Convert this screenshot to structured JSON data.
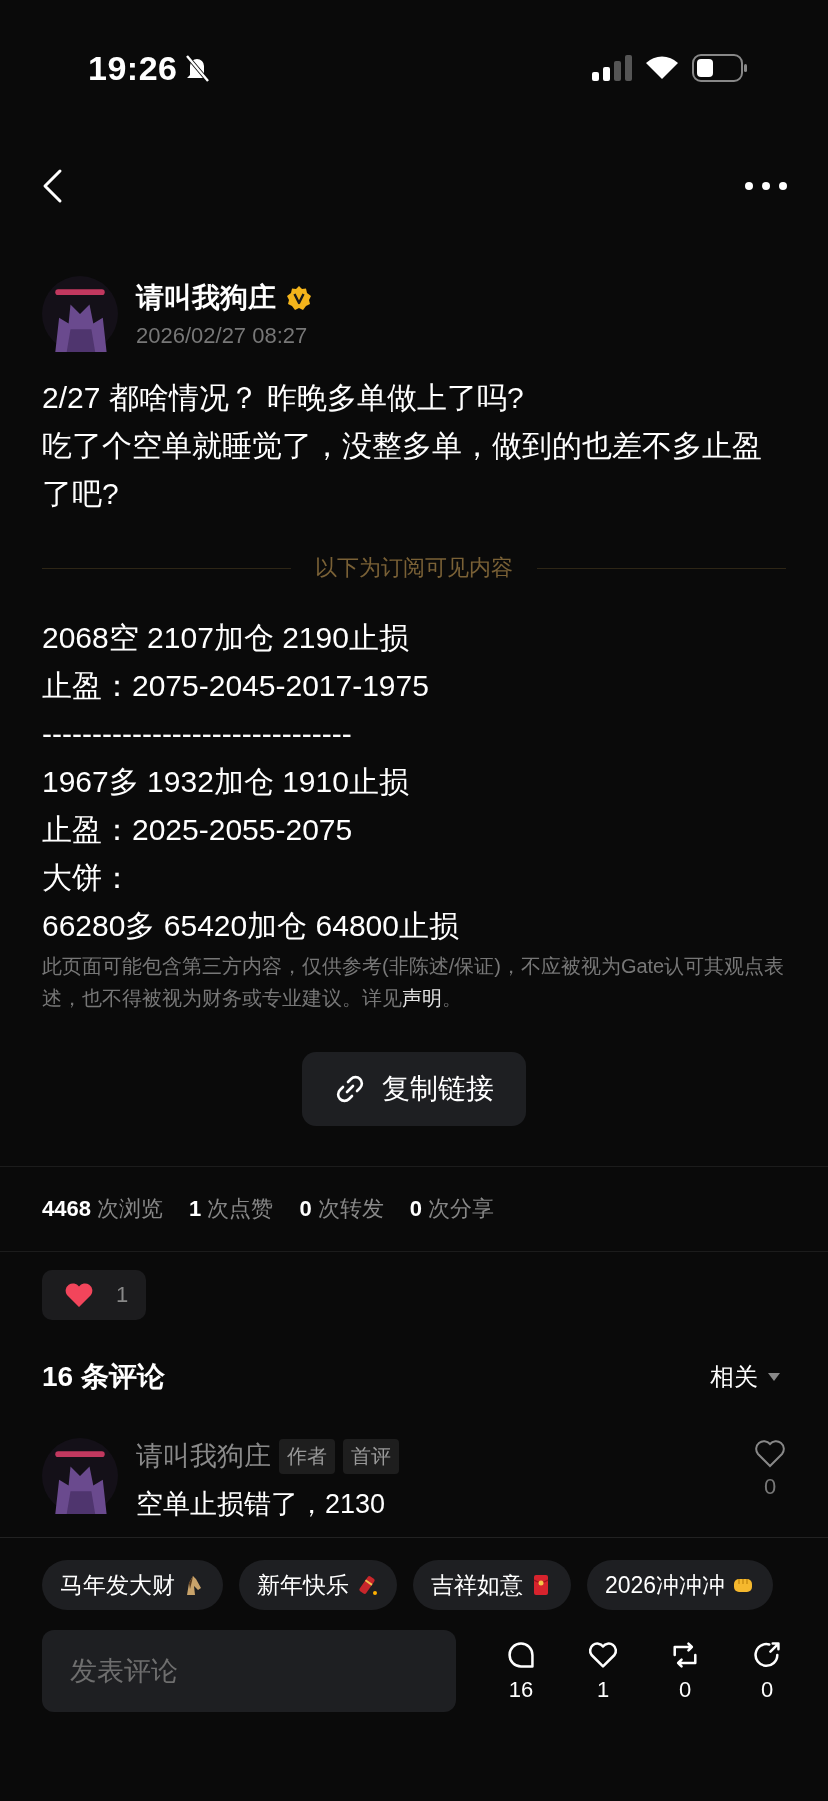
{
  "status_bar": {
    "time": "19:26",
    "silent": true
  },
  "author": {
    "name": "请叫我狗庄",
    "verified": true,
    "date": "2026/02/27 08:27"
  },
  "post": {
    "lines": [
      "2/27 都啥情况？ 昨晚多单做上了吗?",
      "吃了个空单就睡觉了，没整多单，做到的也差不多止盈了吧?"
    ],
    "paywall_label": "以下为订阅可见内容",
    "paid_lines": [
      "2068空 2107加仓 2190止损",
      "止盈：2075-2045-2017-1975",
      "-------------------------------",
      "1967多 1932加仓  1910止损",
      "止盈：2025-2055-2075",
      "大饼：",
      "66280多  65420加仓 64800止损"
    ],
    "disclaimer": {
      "text": "此页面可能包含第三方内容，仅供参考(非陈述/保证)，不应被视为Gate认可其观点表述，也不得被视为财务或专业建议。详见",
      "link": "声明",
      "tail": "。"
    },
    "copy_button": "复制链接"
  },
  "stats": [
    "**4468** 次浏览",
    "**1** 次点赞",
    "**0** 次转发",
    "**0** 次分享"
  ],
  "reaction": {
    "count": "1"
  },
  "comments_header": {
    "title": "16 条评论",
    "sort": "相关"
  },
  "comments": [
    {
      "name": "请叫我狗庄",
      "badges": [
        "作者",
        "首评"
      ],
      "text": "空单止损错了，2130",
      "likes": "0",
      "liked": false
    }
  ],
  "quick_replies": [
    {
      "label": "马年发大财",
      "kind": "horse"
    },
    {
      "label": "新年快乐",
      "kind": "firecracker"
    },
    {
      "label": "吉祥如意",
      "kind": "envelope"
    },
    {
      "label": "2026冲冲冲",
      "kind": "fist"
    }
  ],
  "comment_input": {
    "placeholder": "发表评论"
  },
  "actions": [
    {
      "kind": "comment",
      "count": "16"
    },
    {
      "kind": "like",
      "count": "1"
    },
    {
      "kind": "repost",
      "count": "0"
    },
    {
      "kind": "share",
      "count": "0"
    }
  ]
}
